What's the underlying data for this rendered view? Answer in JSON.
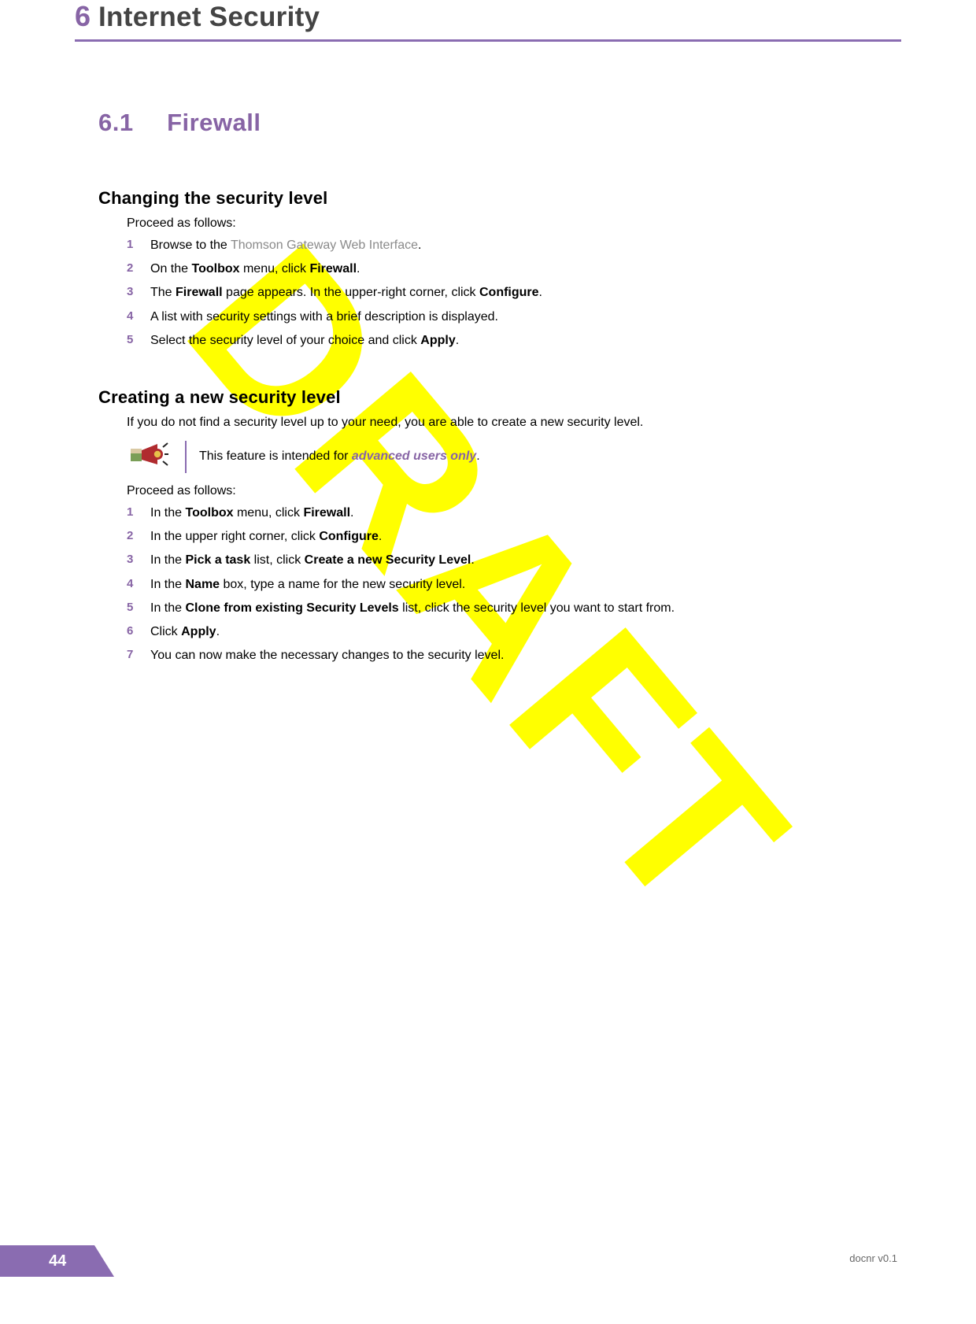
{
  "watermark": "DRAFT",
  "chapter": {
    "number": "6",
    "title": "Internet Security"
  },
  "section": {
    "number": "6.1",
    "title": "Firewall"
  },
  "block1": {
    "heading": "Changing the security level",
    "intro": "Proceed as follows:",
    "steps": [
      {
        "num": "1",
        "pre": "Browse to the ",
        "link": "Thomson Gateway Web Interface",
        "post": "."
      },
      {
        "num": "2",
        "pre": "On the ",
        "b1": "Toolbox",
        "mid1": " menu, click ",
        "b2": "Firewall",
        "post": "."
      },
      {
        "num": "3",
        "pre": "The ",
        "b1": "Firewall",
        "mid1": " page appears. In the upper-right corner, click ",
        "b2": "Configure",
        "post": "."
      },
      {
        "num": "4",
        "text": "A list with security settings with a brief description is displayed."
      },
      {
        "num": "5",
        "pre": "Select the security level of your choice and click ",
        "b1": "Apply",
        "post": "."
      }
    ]
  },
  "block2": {
    "heading": "Creating a new security level",
    "intro1": "If you do not find a security level up to your need, you are able to create a new security level.",
    "note_pre": "This feature is intended for ",
    "note_em": "advanced users only",
    "note_post": ".",
    "intro2": "Proceed as follows:",
    "steps": [
      {
        "num": "1",
        "pre": "In the ",
        "b1": "Toolbox",
        "mid1": " menu, click ",
        "b2": "Firewall",
        "post": "."
      },
      {
        "num": "2",
        "pre": "In the upper right corner, click ",
        "b1": "Configure",
        "post": "."
      },
      {
        "num": "3",
        "pre": "In the ",
        "b1": "Pick a task",
        "mid1": " list, click ",
        "b2": "Create a new Security Level",
        "post": "."
      },
      {
        "num": "4",
        "pre": "In the ",
        "b1": "Name",
        "mid1": " box, type a name for the new security level.",
        "post": ""
      },
      {
        "num": "5",
        "pre": "In the ",
        "b1": "Clone from existing Security Levels",
        "mid1": " list, click the security level you want to start from.",
        "post": ""
      },
      {
        "num": "6",
        "pre": "Click ",
        "b1": "Apply",
        "post": "."
      },
      {
        "num": "7",
        "text": "You can now make the necessary changes to the security level."
      }
    ]
  },
  "footer": {
    "page": "44",
    "doc": "docnr v0.1"
  }
}
